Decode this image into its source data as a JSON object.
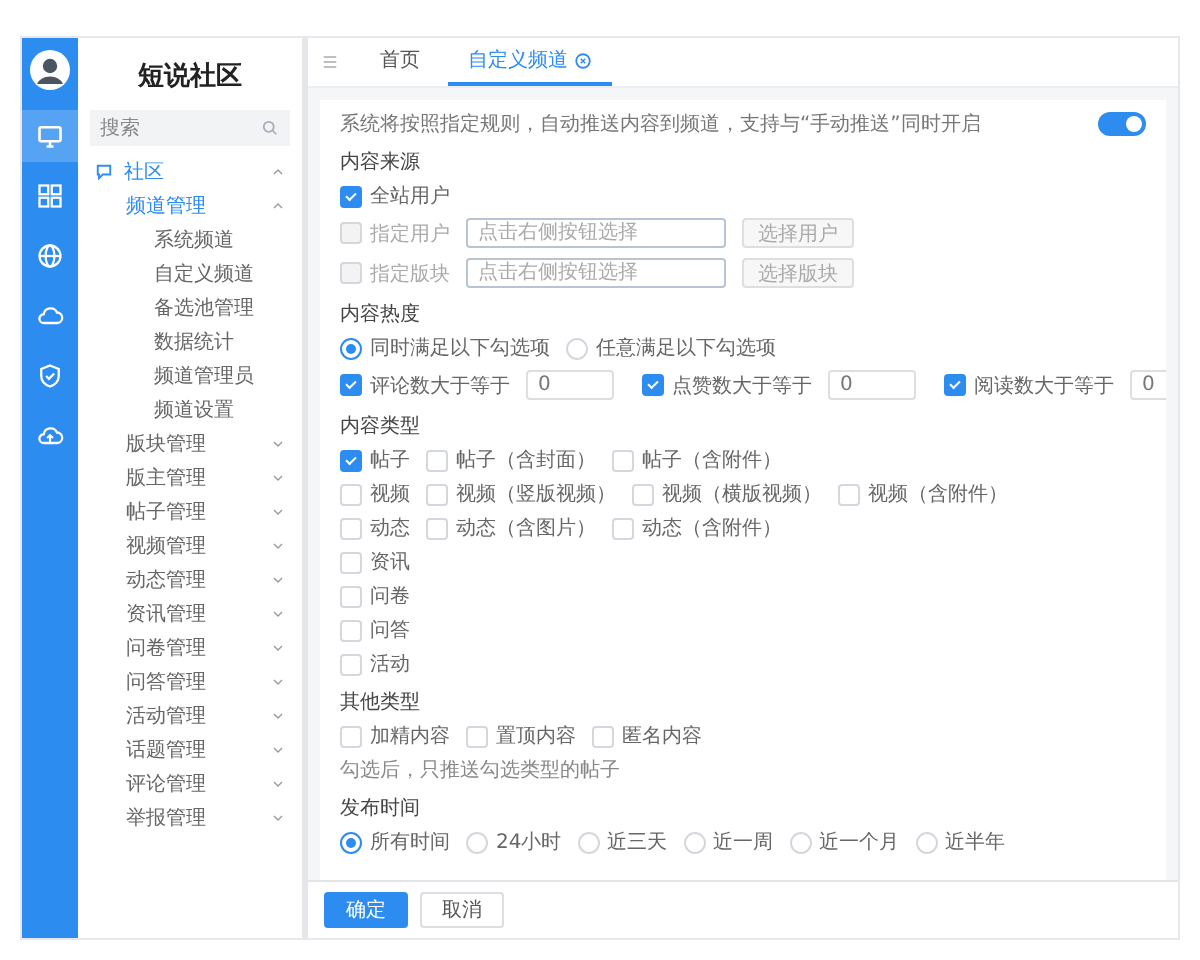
{
  "logo": {
    "title": "短说社区"
  },
  "rail": {
    "items": [
      {
        "kind": "monitor",
        "selected": true
      },
      {
        "kind": "grid",
        "selected": false
      },
      {
        "kind": "globe",
        "selected": false
      },
      {
        "kind": "cloud",
        "selected": false
      },
      {
        "kind": "shield",
        "selected": false
      },
      {
        "kind": "upload",
        "selected": false
      }
    ]
  },
  "sidebar": {
    "search": {
      "placeholder": "搜索"
    },
    "items": [
      {
        "label": "社区",
        "expanded": true,
        "children": [
          {
            "label": "频道管理",
            "expanded": true,
            "children": [
              {
                "label": "系统频道"
              },
              {
                "label": "自定义频道"
              },
              {
                "label": "备选池管理"
              },
              {
                "label": "数据统计"
              },
              {
                "label": "频道管理员"
              },
              {
                "label": "频道设置"
              }
            ]
          },
          {
            "label": "版块管理",
            "expanded": false
          },
          {
            "label": "版主管理",
            "expanded": false
          },
          {
            "label": "帖子管理",
            "expanded": false
          },
          {
            "label": "视频管理",
            "expanded": false
          },
          {
            "label": "动态管理",
            "expanded": false
          },
          {
            "label": "资讯管理",
            "expanded": false
          },
          {
            "label": "问卷管理",
            "expanded": false
          },
          {
            "label": "问答管理",
            "expanded": false
          },
          {
            "label": "活动管理",
            "expanded": false
          },
          {
            "label": "话题管理",
            "expanded": false
          },
          {
            "label": "评论管理",
            "expanded": false
          },
          {
            "label": "举报管理",
            "expanded": false
          }
        ]
      }
    ]
  },
  "tabs": [
    {
      "label": "首页",
      "selected": false,
      "closable": false
    },
    {
      "label": "自定义频道",
      "selected": true,
      "closable": true
    }
  ],
  "form": {
    "toggle": {
      "on": true
    },
    "description": "系统将按照指定规则，自动推送内容到频道，支持与“手动推送”同时开启",
    "sections": [
      {
        "title": "内容来源",
        "rows": [
          {
            "items": [
              {
                "kind": "checkbox",
                "label": "全站用户",
                "checked": true
              }
            ]
          },
          {
            "items": [
              {
                "kind": "checkbox",
                "label": "指定用户",
                "checked": false,
                "disabled": true
              },
              {
                "kind": "field",
                "placeholder": "点击右侧按钮选择"
              },
              {
                "kind": "button",
                "label": "选择用户",
                "disabled": true
              }
            ]
          },
          {
            "items": [
              {
                "kind": "checkbox",
                "label": "指定版块",
                "checked": false,
                "disabled": true
              },
              {
                "kind": "field",
                "placeholder": "点击右侧按钮选择"
              },
              {
                "kind": "button",
                "label": "选择版块",
                "disabled": true
              }
            ]
          }
        ]
      },
      {
        "title": "内容热度",
        "rows": [
          {
            "items": [
              {
                "kind": "radio",
                "label": "同时满足以下勾选项",
                "selected": true
              },
              {
                "kind": "radio",
                "label": "任意满足以下勾选项",
                "selected": false
              }
            ]
          },
          {
            "items": [
              {
                "kind": "checkbox",
                "label": "评论数大于等于",
                "checked": true
              },
              {
                "kind": "field",
                "value": "0"
              },
              {
                "kind": "checkbox",
                "label": "点赞数大于等于",
                "checked": true
              },
              {
                "kind": "field",
                "value": "0"
              },
              {
                "kind": "checkbox",
                "label": "阅读数大于等于",
                "checked": true
              },
              {
                "kind": "field",
                "value": "0"
              }
            ]
          }
        ]
      },
      {
        "title": "内容类型",
        "rows": [
          {
            "items": [
              {
                "kind": "checkbox",
                "label": "帖子",
                "checked": true
              },
              {
                "kind": "checkbox",
                "label": "帖子（含封面）",
                "checked": false
              },
              {
                "kind": "checkbox",
                "label": "帖子（含附件）",
                "checked": false
              }
            ]
          },
          {
            "items": [
              {
                "kind": "checkbox",
                "label": "视频",
                "checked": false
              },
              {
                "kind": "checkbox",
                "label": "视频（竖版视频）",
                "checked": false
              },
              {
                "kind": "checkbox",
                "label": "视频（横版视频）",
                "checked": false
              },
              {
                "kind": "checkbox",
                "label": "视频（含附件）",
                "checked": false
              }
            ]
          },
          {
            "items": [
              {
                "kind": "checkbox",
                "label": "动态",
                "checked": false
              },
              {
                "kind": "checkbox",
                "label": "动态（含图片）",
                "checked": false
              },
              {
                "kind": "checkbox",
                "label": "动态（含附件）",
                "checked": false
              }
            ]
          },
          {
            "items": [
              {
                "kind": "checkbox",
                "label": "资讯",
                "checked": false
              }
            ]
          },
          {
            "items": [
              {
                "kind": "checkbox",
                "label": "问卷",
                "checked": false
              }
            ]
          },
          {
            "items": [
              {
                "kind": "checkbox",
                "label": "问答",
                "checked": false
              }
            ]
          },
          {
            "items": [
              {
                "kind": "checkbox",
                "label": "活动",
                "checked": false
              }
            ]
          }
        ]
      },
      {
        "title": "其他类型",
        "rows": [
          {
            "items": [
              {
                "kind": "checkbox",
                "label": "加精内容",
                "checked": false
              },
              {
                "kind": "checkbox",
                "label": "置顶内容",
                "checked": false
              },
              {
                "kind": "checkbox",
                "label": "匿名内容",
                "checked": false
              }
            ]
          },
          {
            "items": [
              {
                "kind": "note",
                "text": "勾选后，只推送勾选类型的帖子"
              }
            ]
          }
        ]
      },
      {
        "title": "发布时间",
        "rows": [
          {
            "items": [
              {
                "kind": "radio",
                "label": "所有时间",
                "selected": true
              },
              {
                "kind": "radio",
                "label": "24小时",
                "selected": false
              },
              {
                "kind": "radio",
                "label": "近三天",
                "selected": false
              },
              {
                "kind": "radio",
                "label": "近一周",
                "selected": false
              },
              {
                "kind": "radio",
                "label": "近一个月",
                "selected": false
              },
              {
                "kind": "radio",
                "label": "近半年",
                "selected": false
              }
            ]
          }
        ]
      }
    ]
  },
  "footer": {
    "buttons": [
      {
        "label": "确定",
        "kind": "primary"
      },
      {
        "label": "取消",
        "kind": "plain"
      }
    ]
  }
}
